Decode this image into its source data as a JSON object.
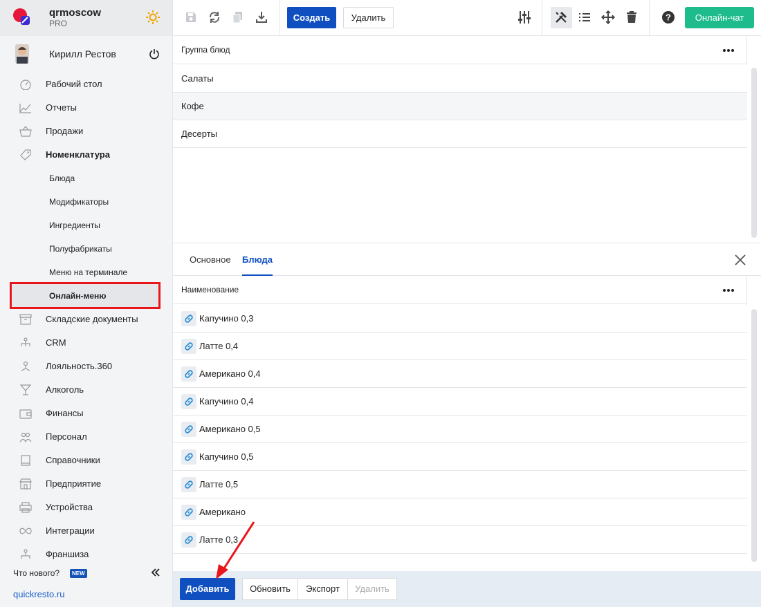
{
  "brand": {
    "name": "qrmoscow",
    "plan": "PRO"
  },
  "user": {
    "name": "Кирилл Рестов"
  },
  "sidebar": {
    "items": [
      {
        "label": "Рабочий стол",
        "icon": "dashboard-icon"
      },
      {
        "label": "Отчеты",
        "icon": "chart-icon"
      },
      {
        "label": "Продажи",
        "icon": "basket-icon"
      },
      {
        "label": "Номенклатура",
        "icon": "tag-icon"
      }
    ],
    "subitems": [
      {
        "label": "Блюда"
      },
      {
        "label": "Модификаторы"
      },
      {
        "label": "Ингредиенты"
      },
      {
        "label": "Полуфабрикаты"
      },
      {
        "label": "Меню на терминале"
      },
      {
        "label": "Онлайн-меню"
      }
    ],
    "items2": [
      {
        "label": "Складские документы",
        "icon": "archive-icon"
      },
      {
        "label": "CRM",
        "icon": "hierarchy-icon"
      },
      {
        "label": "Лояльность.360",
        "icon": "loyalty-icon"
      },
      {
        "label": "Алкоголь",
        "icon": "glass-icon"
      },
      {
        "label": "Финансы",
        "icon": "wallet-icon"
      },
      {
        "label": "Персонал",
        "icon": "people-icon"
      },
      {
        "label": "Справочники",
        "icon": "book-icon"
      },
      {
        "label": "Предприятие",
        "icon": "store-icon"
      },
      {
        "label": "Устройства",
        "icon": "printer-icon"
      },
      {
        "label": "Интеграции",
        "icon": "infinity-icon"
      },
      {
        "label": "Франшиза",
        "icon": "franchise-icon"
      }
    ],
    "whats_new": "Что нового?",
    "new_badge": "NEW",
    "site": "quickresto.ru"
  },
  "toolbar": {
    "create_label": "Создать",
    "delete_label": "Удалить",
    "chat_label": "Онлайн-чат"
  },
  "groups": {
    "header": "Группа блюд",
    "rows": [
      "Салаты",
      "Кофе",
      "Десерты"
    ]
  },
  "tabs": [
    {
      "label": "Основное",
      "active": false
    },
    {
      "label": "Блюда",
      "active": true
    }
  ],
  "dishes": {
    "header": "Наименование",
    "rows": [
      "Капучино 0,3",
      "Латте 0,4",
      "Американо 0,4",
      "Капучино 0,4",
      "Американо 0,5",
      "Капучино 0,5",
      "Латте 0,5",
      "Американо",
      "Латте 0,3"
    ]
  },
  "footer": {
    "add_label": "Добавить",
    "refresh_label": "Обновить",
    "export_label": "Экспорт",
    "delete_label": "Удалить"
  },
  "colors": {
    "accent": "#0f4fc0",
    "chat": "#1ebc8c",
    "highlight": "#e8161b"
  }
}
